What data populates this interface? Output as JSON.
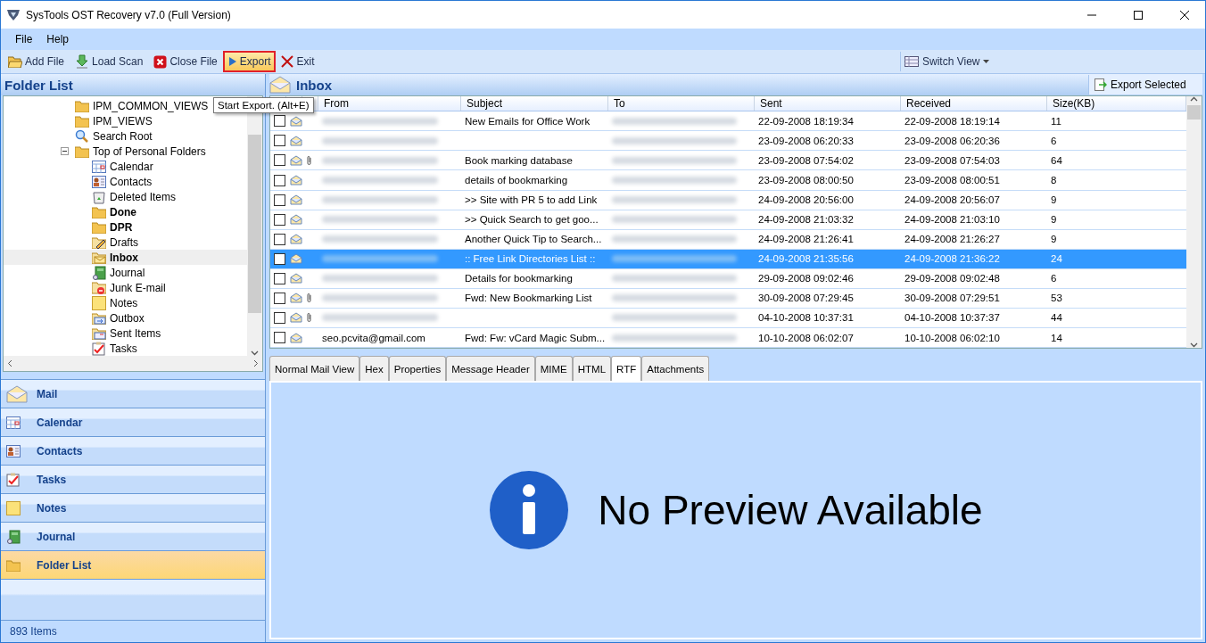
{
  "window": {
    "title": "SysTools OST Recovery v7.0 (Full Version)"
  },
  "menu": [
    "File",
    "Help"
  ],
  "toolbar": [
    {
      "kind": "add",
      "label": "Add File",
      "highlighted": false
    },
    {
      "kind": "load",
      "label": "Load Scan",
      "highlighted": false
    },
    {
      "kind": "close",
      "label": "Close File",
      "highlighted": false
    },
    {
      "kind": "export",
      "label": "Export",
      "highlighted": true
    },
    {
      "kind": "exit",
      "label": "Exit",
      "highlighted": false
    }
  ],
  "switch_view": "Switch View",
  "tooltip": "Start Export. (Alt+E)",
  "folder_panel": {
    "title": "Folder List",
    "tree": [
      {
        "label": "IPM_COMMON_VIEWS",
        "bold": false,
        "selected": false
      },
      {
        "label": "IPM_VIEWS",
        "bold": false,
        "selected": false
      },
      {
        "label": "Search Root",
        "bold": false,
        "selected": false
      },
      {
        "label": "Top of Personal Folders",
        "bold": false,
        "selected": false,
        "expanded": true,
        "children": [
          {
            "label": "Calendar",
            "bold": false,
            "selected": false
          },
          {
            "label": "Contacts",
            "bold": false,
            "selected": false
          },
          {
            "label": "Deleted Items",
            "bold": false,
            "selected": false
          },
          {
            "label": "Done",
            "bold": true,
            "selected": false
          },
          {
            "label": "DPR",
            "bold": true,
            "selected": false
          },
          {
            "label": "Drafts",
            "bold": false,
            "selected": false
          },
          {
            "label": "Inbox",
            "bold": true,
            "selected": true
          },
          {
            "label": "Journal",
            "bold": false,
            "selected": false
          },
          {
            "label": "Junk E-mail",
            "bold": false,
            "selected": false
          },
          {
            "label": "Notes",
            "bold": false,
            "selected": false
          },
          {
            "label": "Outbox",
            "bold": false,
            "selected": false
          },
          {
            "label": "Sent Items",
            "bold": false,
            "selected": false
          },
          {
            "label": "Tasks",
            "bold": false,
            "selected": false
          }
        ]
      }
    ]
  },
  "nav": [
    {
      "label": "Mail",
      "selected": false
    },
    {
      "label": "Calendar",
      "selected": false
    },
    {
      "label": "Contacts",
      "selected": false
    },
    {
      "label": "Tasks",
      "selected": false
    },
    {
      "label": "Notes",
      "selected": false
    },
    {
      "label": "Journal",
      "selected": false
    },
    {
      "label": "Folder List",
      "selected": true
    }
  ],
  "status_bar": "893 Items",
  "mail_panel": {
    "title": "Inbox",
    "export_selected": "Export Selected",
    "columns": [
      "From",
      "Subject",
      "To",
      "Sent",
      "Received",
      "Size(KB)"
    ],
    "rows": [
      {
        "checked": false,
        "attachment": false,
        "selected": false,
        "subject": "New Emails for Office Work",
        "sent": "22-09-2008 18:19:34",
        "received": "22-09-2008 18:19:14",
        "size": "11"
      },
      {
        "checked": false,
        "attachment": false,
        "selected": false,
        "sent": "23-09-2008 06:20:33",
        "received": "23-09-2008 06:20:36",
        "size": "6"
      },
      {
        "checked": false,
        "attachment": true,
        "selected": false,
        "subject": "Book marking database",
        "sent": "23-09-2008 07:54:02",
        "received": "23-09-2008 07:54:03",
        "size": "64"
      },
      {
        "checked": false,
        "attachment": false,
        "selected": false,
        "subject": "details of bookmarking",
        "sent": "23-09-2008 08:00:50",
        "received": "23-09-2008 08:00:51",
        "size": "8"
      },
      {
        "checked": false,
        "attachment": false,
        "selected": false,
        "subject": ">> Site with PR 5 to add Link",
        "sent": "24-09-2008 20:56:00",
        "received": "24-09-2008 20:56:07",
        "size": "9"
      },
      {
        "checked": false,
        "attachment": false,
        "selected": false,
        "subject": ">> Quick Search to get goo...",
        "sent": "24-09-2008 21:03:32",
        "received": "24-09-2008 21:03:10",
        "size": "9"
      },
      {
        "checked": false,
        "attachment": false,
        "selected": false,
        "subject": "Another Quick Tip to Search...",
        "sent": "24-09-2008 21:26:41",
        "received": "24-09-2008 21:26:27",
        "size": "9"
      },
      {
        "checked": false,
        "attachment": false,
        "selected": true,
        "subject": ":: Free Link Directories List ::",
        "sent": "24-09-2008 21:35:56",
        "received": "24-09-2008 21:36:22",
        "size": "24"
      },
      {
        "checked": false,
        "attachment": false,
        "selected": false,
        "subject": "Details for bookmarking",
        "sent": "29-09-2008 09:02:46",
        "received": "29-09-2008 09:02:48",
        "size": "6"
      },
      {
        "checked": false,
        "attachment": true,
        "selected": false,
        "subject": "Fwd: New Bookmarking List",
        "sent": "30-09-2008 07:29:45",
        "received": "30-09-2008 07:29:51",
        "size": "53"
      },
      {
        "checked": false,
        "attachment": true,
        "selected": false,
        "sent": "04-10-2008 10:37:31",
        "received": "04-10-2008 10:37:37",
        "size": "44"
      },
      {
        "checked": false,
        "attachment": false,
        "selected": false,
        "from": "seo.pcvita@gmail.com",
        "subject": "Fwd: Fw: vCard Magic Subm...",
        "sent": "10-10-2008 06:02:07",
        "received": "10-10-2008 06:02:10",
        "size": "14"
      }
    ]
  },
  "preview_tabs": [
    {
      "label": "Normal Mail View",
      "selected": false
    },
    {
      "label": "Hex",
      "selected": false
    },
    {
      "label": "Properties",
      "selected": false
    },
    {
      "label": "Message Header",
      "selected": false
    },
    {
      "label": "MIME",
      "selected": false
    },
    {
      "label": "HTML",
      "selected": false
    },
    {
      "label": "RTF",
      "selected": true
    },
    {
      "label": "Attachments",
      "selected": false
    }
  ],
  "preview_message": "No Preview Available"
}
